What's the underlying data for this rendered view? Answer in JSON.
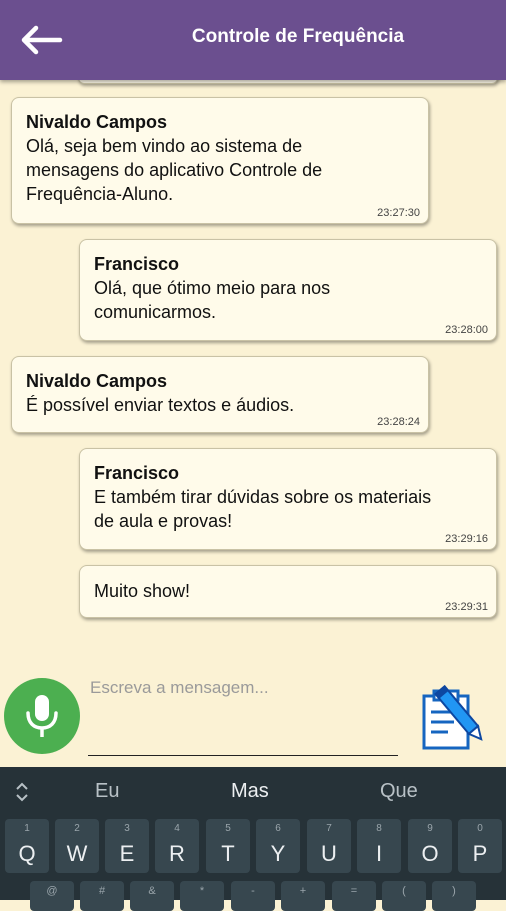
{
  "header": {
    "title": "Controle de Frequência",
    "back_icon": "arrow-left-icon",
    "color": "#6b4f8f"
  },
  "messages": [
    {
      "sender": "Nivaldo Campos",
      "lines": [
        "Olá, seja bem vindo ao sistema de",
        "mensagens do aplicativo Controle de",
        "Frequência-Aluno."
      ],
      "time": "23:27:30",
      "side": "left"
    },
    {
      "sender": "Francisco",
      "lines": [
        "Olá, que ótimo meio para nos",
        "comunicarmos."
      ],
      "time": "23:28:00",
      "side": "right"
    },
    {
      "sender": "Nivaldo Campos",
      "lines": [
        "É possível enviar textos e áudios."
      ],
      "time": "23:28:24",
      "side": "left"
    },
    {
      "sender": "Francisco",
      "lines": [
        "E também tirar dúvidas sobre os materiais",
        "de aula e provas!"
      ],
      "time": "23:29:16",
      "side": "right"
    },
    {
      "sender": "",
      "lines": [
        "Muito show!"
      ],
      "time": "23:29:31",
      "side": "right"
    }
  ],
  "composer": {
    "placeholder": "Escreva a mensagem...",
    "value": "",
    "mic_icon": "microphone-icon",
    "mic_color": "#4caf50",
    "send_icon": "notepad-pencil-icon"
  },
  "keyboard": {
    "suggestions": [
      "Eu",
      "Mas",
      "Que"
    ],
    "row1": [
      {
        "digit": "1",
        "letter": "Q"
      },
      {
        "digit": "2",
        "letter": "W"
      },
      {
        "digit": "3",
        "letter": "E"
      },
      {
        "digit": "4",
        "letter": "R"
      },
      {
        "digit": "5",
        "letter": "T"
      },
      {
        "digit": "6",
        "letter": "Y"
      },
      {
        "digit": "7",
        "letter": "U"
      },
      {
        "digit": "8",
        "letter": "I"
      },
      {
        "digit": "9",
        "letter": "O"
      },
      {
        "digit": "0",
        "letter": "P"
      }
    ],
    "row2_symbols": [
      "@",
      "#",
      "&",
      "*",
      "-",
      "+",
      "=",
      "(",
      ")"
    ]
  }
}
